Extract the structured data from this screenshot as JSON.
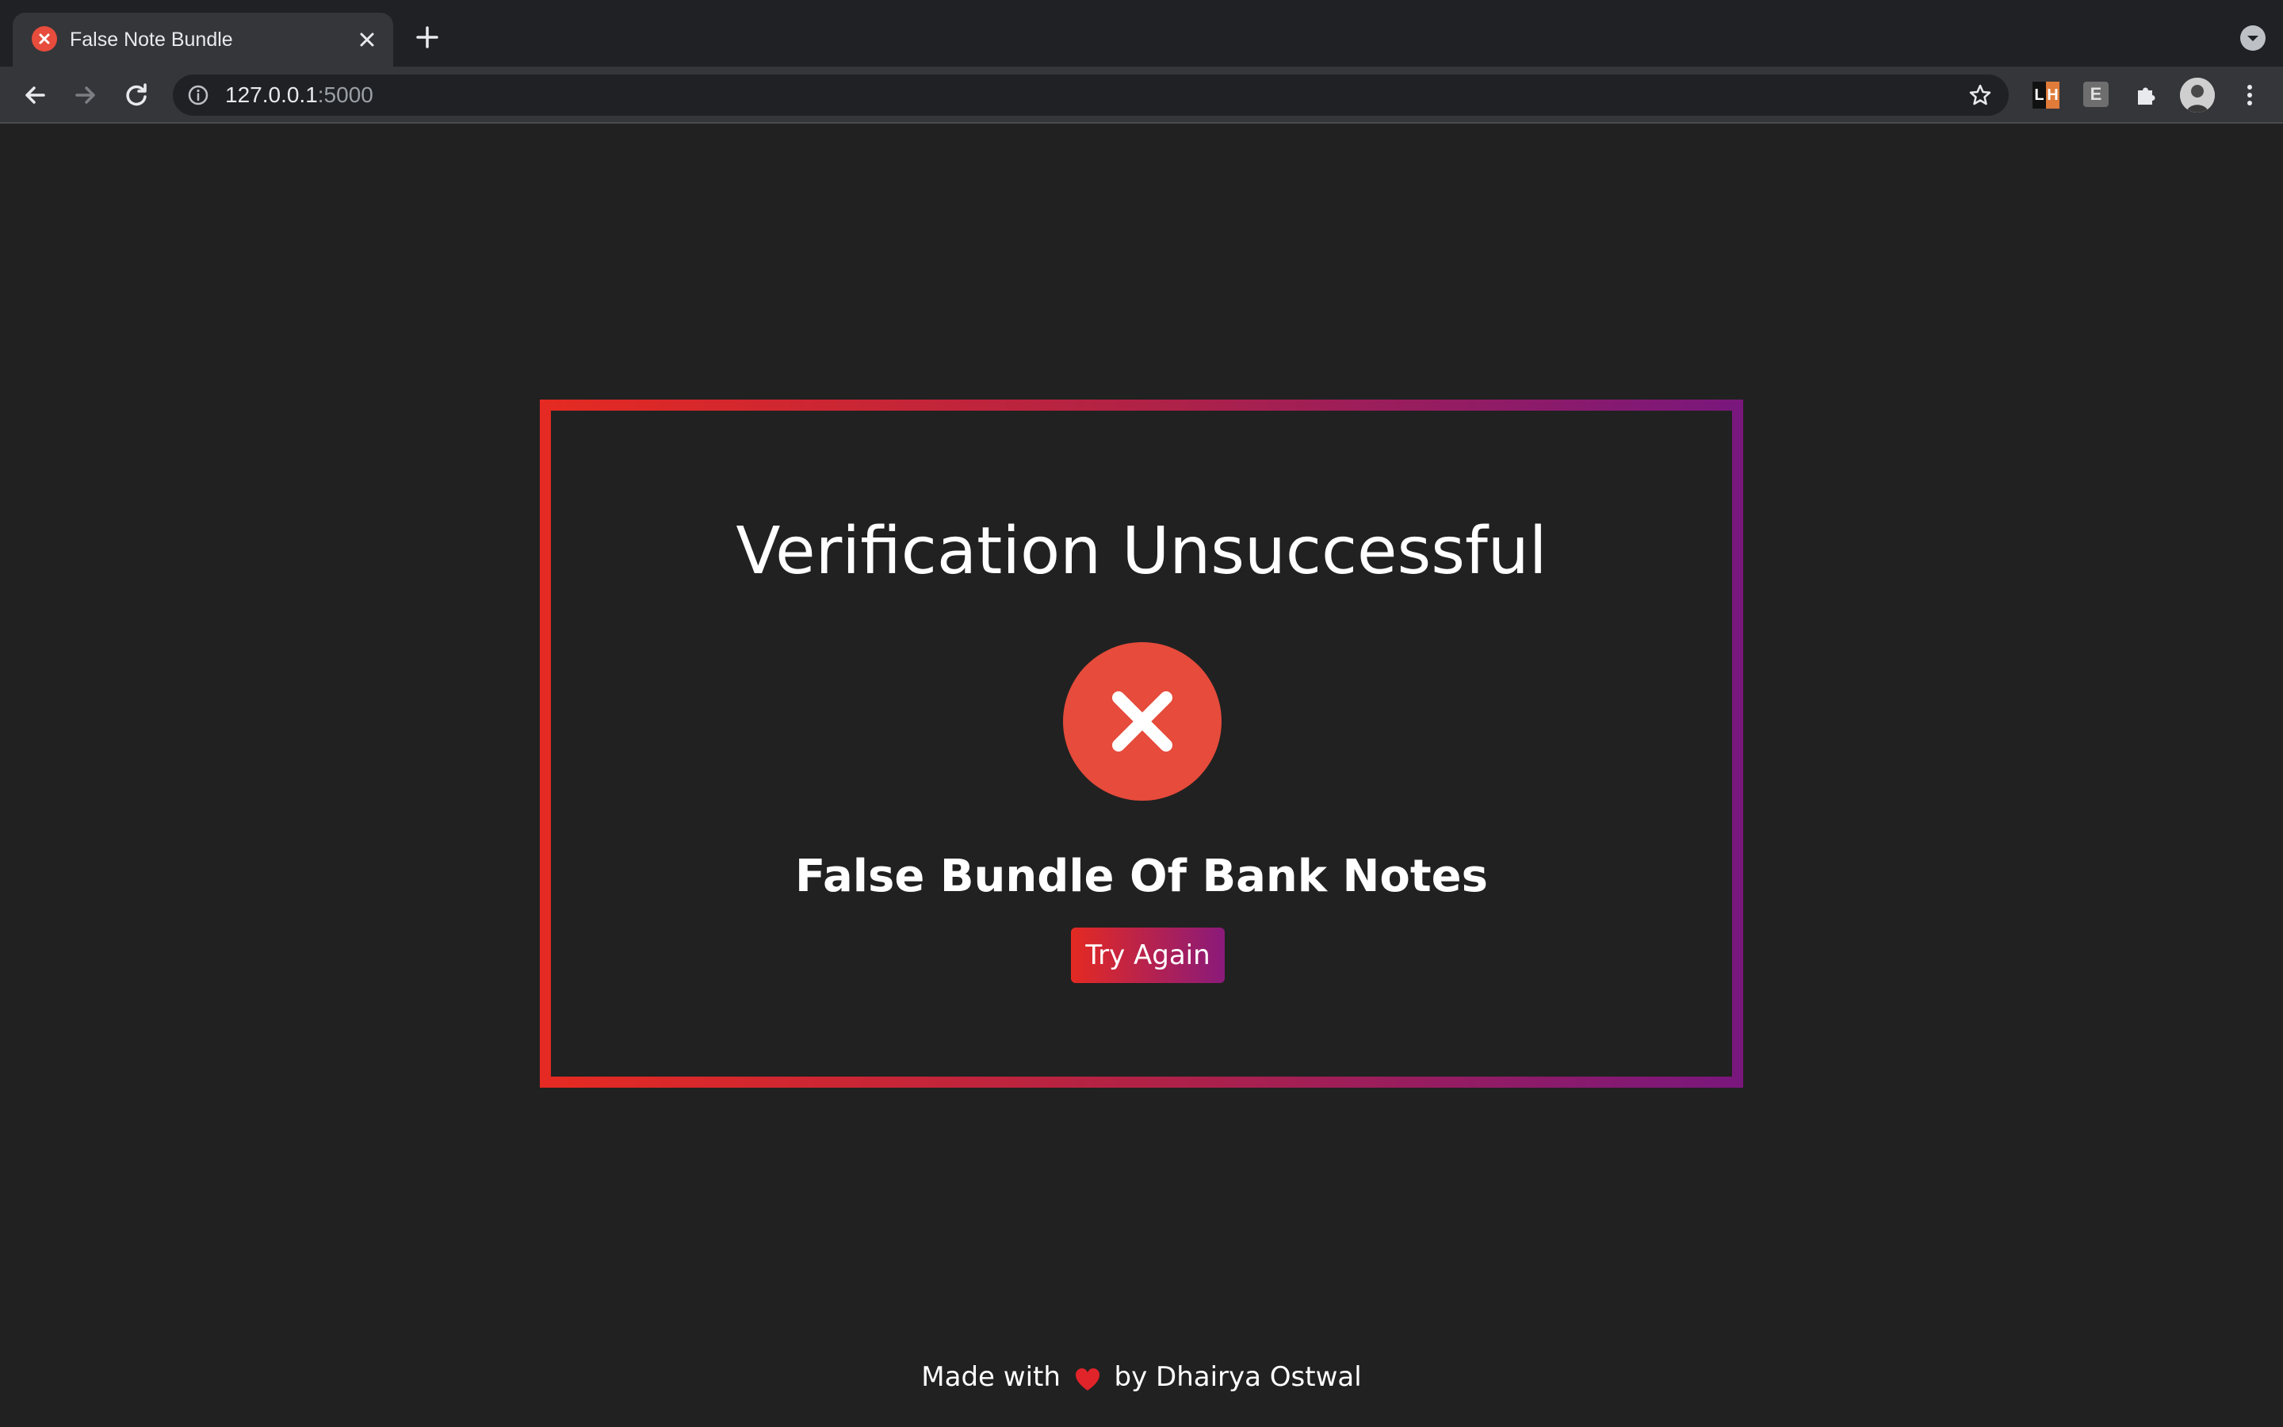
{
  "browser": {
    "tab": {
      "title": "False Note Bundle",
      "favicon": "error-x-icon"
    },
    "address_bar": {
      "host": "127.0.0.1",
      "port": ":5000"
    },
    "extensions": {
      "lighthouse": {
        "left": "L",
        "right": "H"
      },
      "e_extension": "E"
    }
  },
  "page": {
    "heading": "Verification Unsuccessful",
    "status_icon": "x-circle-icon",
    "result": "False Bundle Of Bank Notes",
    "button_label": "Try Again",
    "footer": {
      "prefix": "Made with",
      "suffix": "by Dhairya Ostwal"
    }
  },
  "colors": {
    "background": "#212121",
    "gradient_start": "#e42a22",
    "gradient_end": "#7a177c",
    "error_red": "#e64b3b"
  }
}
